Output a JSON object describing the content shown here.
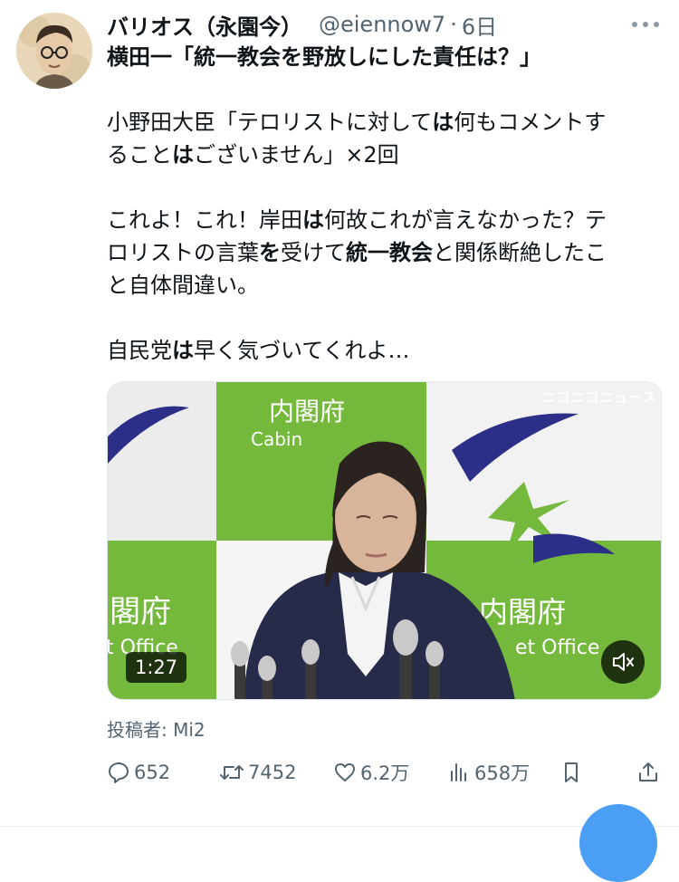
{
  "tweet": {
    "display_name": "バリオス（永園今）",
    "handle": "@eiennow7",
    "separator": "·",
    "time": "6日",
    "title_line": "横田一「統一教会を野放しにした責任は？」",
    "paragraph1_line1_a": "小野田大臣「テロリストに対して",
    "paragraph1_line1_b": "は",
    "paragraph1_line1_c": "何もコメントす",
    "paragraph1_line2_a": "ること",
    "paragraph1_line2_b": "は",
    "paragraph1_line2_c": "ございません」×2回",
    "paragraph2_line1_a": "これよ！これ！岸田",
    "paragraph2_line1_b": "は",
    "paragraph2_line1_c": "何故これが言えなかった？テ",
    "paragraph2_line2_a": "ロリストの言葉",
    "paragraph2_line2_b": "を",
    "paragraph2_line2_c": "受けて",
    "paragraph2_line2_d": "統一教会",
    "paragraph2_line2_e": "と関係断絶したこ",
    "paragraph2_line3": "と自体間違い。",
    "paragraph3_a": "自民党",
    "paragraph3_b": "は",
    "paragraph3_c": "早く気づいてくれよ…"
  },
  "video": {
    "duration": "1:27",
    "watermark": "ニコニコニュース",
    "sign_top_jp": "内閣府",
    "sign_top_en": "Cabin",
    "sign_bottom_left_jp": "閣府",
    "sign_bottom_left_en": "t Office",
    "sign_bottom_right_jp": "内閣府",
    "sign_bottom_right_en": "et Office"
  },
  "poster": "投稿者: Mi2",
  "actions": {
    "replies": "652",
    "retweets": "7452",
    "likes": "6.2万",
    "views": "658万"
  },
  "colors": {
    "text": "#0f1419",
    "secondary": "#536471",
    "green": "#74b83c",
    "navy": "#262b4a",
    "blue": "#4a9ff5"
  }
}
